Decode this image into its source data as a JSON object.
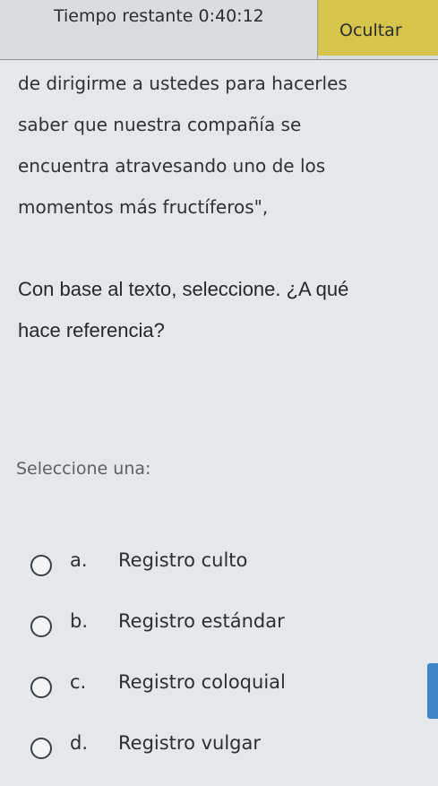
{
  "timer": {
    "label": "Tiempo restante 0:40:12",
    "hide_button": "Ocultar"
  },
  "passage": {
    "lines": [
      "de dirigirme a ustedes para hacerles",
      "saber que nuestra compañía se",
      "encuentra atravesando uno de los",
      "momentos más fructíferos\","
    ]
  },
  "question": {
    "lines": [
      "Con base al texto, seleccione. ¿A qué",
      "hace referencia?"
    ]
  },
  "select_prompt": "Seleccione una:",
  "options": [
    {
      "letter": "a.",
      "label": "Registro culto"
    },
    {
      "letter": "b.",
      "label": "Registro estándar"
    },
    {
      "letter": "c.",
      "label": "Registro coloquial"
    },
    {
      "letter": "d.",
      "label": "Registro vulgar"
    }
  ],
  "colors": {
    "hide_button_bg": "#d6c54a",
    "side_tab": "#3f86c9",
    "background": "#e4e8eb"
  }
}
